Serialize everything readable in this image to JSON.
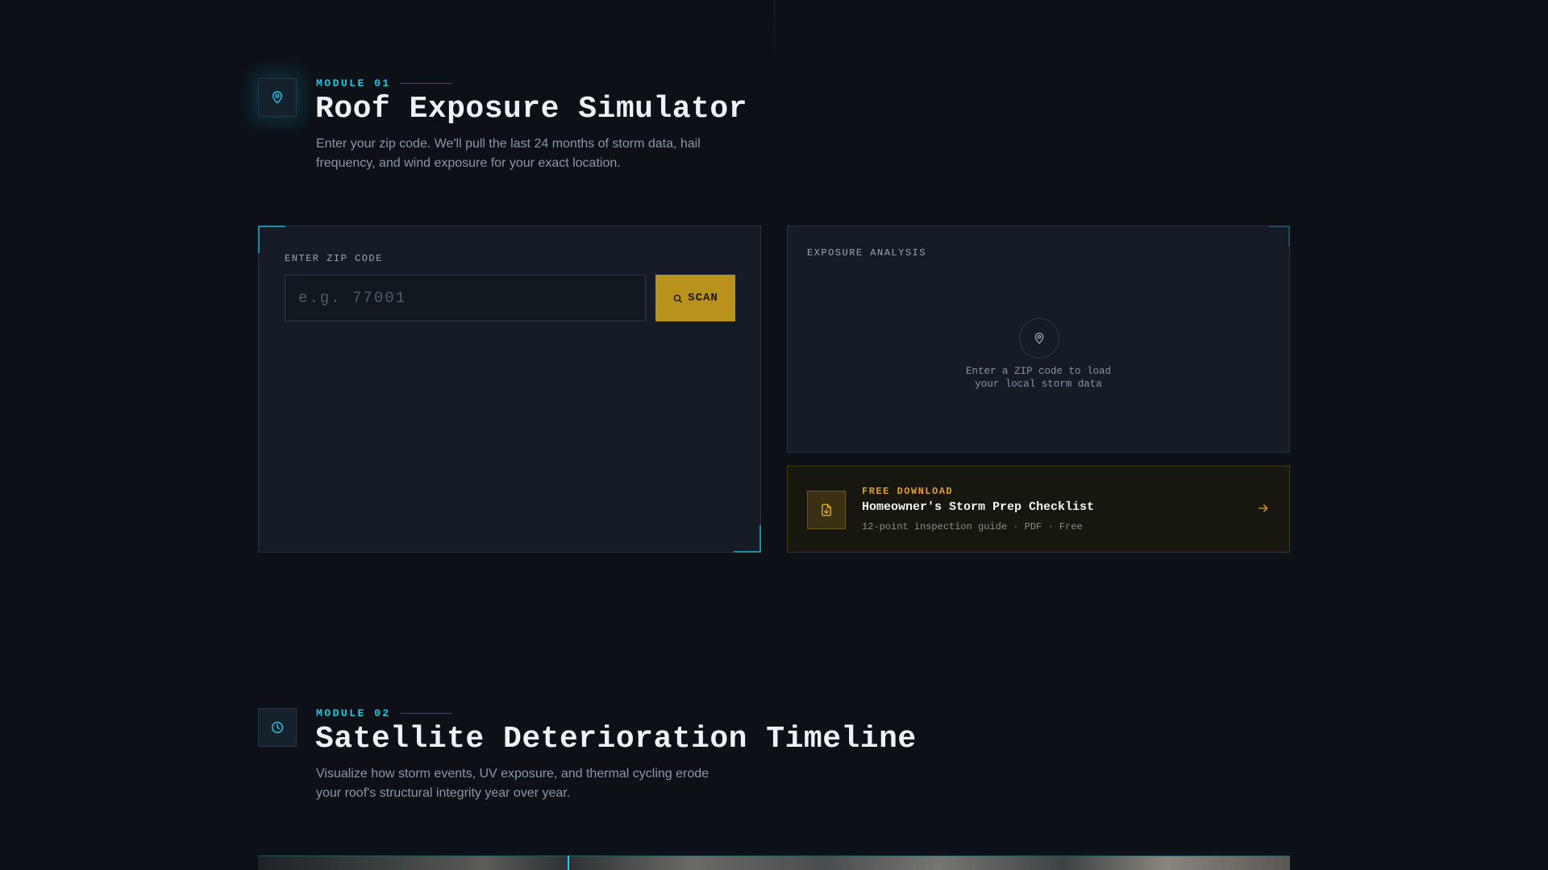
{
  "module1": {
    "eyebrow": "MODULE 01",
    "icon": "map-pin-icon",
    "title": "Roof Exposure Simulator",
    "description": "Enter your zip code. We'll pull the last 24 months of storm data, hail frequency, and wind exposure for your exact location."
  },
  "zip_panel": {
    "label": "ENTER ZIP CODE",
    "placeholder": "e.g. 77001",
    "value": "",
    "scan_label": "SCAN",
    "scan_icon": "search-icon"
  },
  "exposure_panel": {
    "label": "EXPOSURE ANALYSIS",
    "icon": "map-pin-icon",
    "empty_line1": "Enter a ZIP code to load",
    "empty_line2": "your local storm data"
  },
  "download": {
    "eyebrow": "FREE DOWNLOAD",
    "title": "Homeowner's Storm Prep Checklist",
    "subtitle": "12-point inspection guide · PDF · Free",
    "icon": "file-download-icon",
    "arrow_icon": "arrow-right-icon"
  },
  "module2": {
    "eyebrow": "MODULE 02",
    "icon": "clock-icon",
    "title": "Satellite Deterioration Timeline",
    "description": "Visualize how storm events, UV exposure, and thermal cycling erode your roof's structural integrity year over year."
  },
  "colors": {
    "accent_cyan": "#22c7e0",
    "accent_gold": "#b8921d",
    "background": "#0d1117",
    "panel": "#151c25"
  }
}
